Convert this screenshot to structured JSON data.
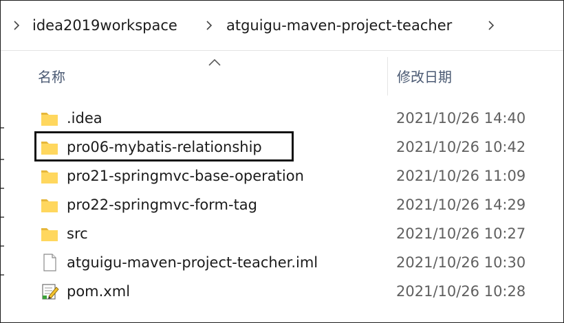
{
  "breadcrumb": {
    "items": [
      {
        "label": "idea2019workspace"
      },
      {
        "label": "atguigu-maven-project-teacher"
      }
    ]
  },
  "columns": {
    "name": "名称",
    "date_modified": "修改日期"
  },
  "files": [
    {
      "name": ".idea",
      "date": "2021/10/26 14:40",
      "icon": "folder-icon"
    },
    {
      "name": "pro06-mybatis-relationship",
      "date": "2021/10/26 10:42",
      "icon": "folder-icon",
      "highlighted": true
    },
    {
      "name": "pro21-springmvc-base-operation",
      "date": "2021/10/26 11:09",
      "icon": "folder-icon"
    },
    {
      "name": "pro22-springmvc-form-tag",
      "date": "2021/10/26 14:29",
      "icon": "folder-icon"
    },
    {
      "name": "src",
      "date": "2021/10/26 10:27",
      "icon": "folder-icon"
    },
    {
      "name": "atguigu-maven-project-teacher.iml",
      "date": "2021/10/26 10:30",
      "icon": "file-icon"
    },
    {
      "name": "pom.xml",
      "date": "2021/10/26 10:28",
      "icon": "xml-file-icon"
    }
  ],
  "colors": {
    "folder": "#ffd75e",
    "folder_dark": "#e6b73a",
    "header_text": "#4b5a73",
    "highlight_border": "#111111"
  }
}
